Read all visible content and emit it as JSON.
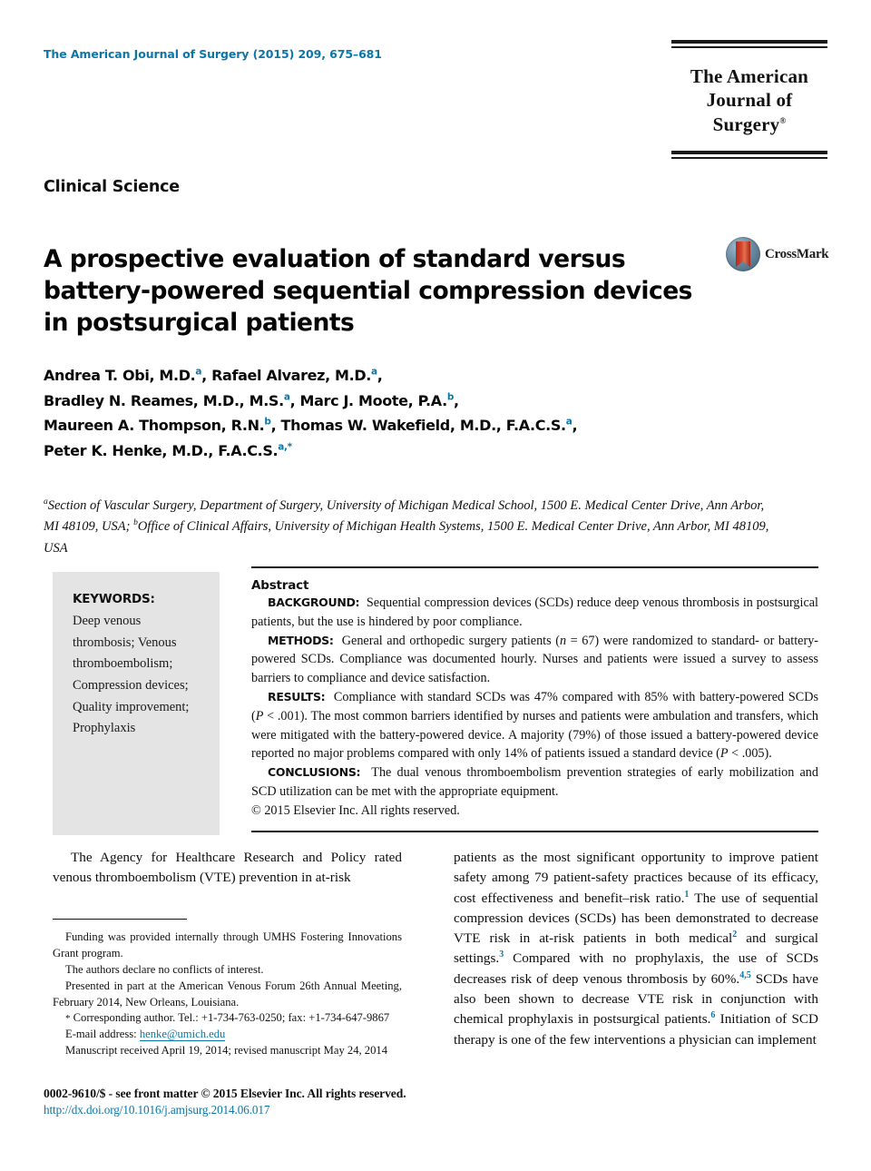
{
  "masthead": {
    "journal_ref": "The American Journal of Surgery (2015) 209, 675–681",
    "logo_line1": "The American",
    "logo_line2": "Journal of Surgery",
    "logo_trademark": "®"
  },
  "section_label": "Clinical Science",
  "title": "A prospective evaluation of standard versus battery-powered sequential compression devices in postsurgical patients",
  "crossmark": {
    "label": "CrossMark"
  },
  "authors": {
    "line1_a": "Andrea T. Obi, M.D.",
    "line1_sup1": "a",
    "line1_b": ", Rafael Alvarez, M.D.",
    "line1_sup2": "a",
    "line1_end": ",",
    "line2_a": "Bradley N. Reames, M.D., M.S.",
    "line2_sup1": "a",
    "line2_b": ", Marc J. Moote, P.A.",
    "line2_sup2": "b",
    "line2_end": ",",
    "line3_a": "Maureen A. Thompson, R.N.",
    "line3_sup1": "b",
    "line3_b": ", Thomas W. Wakefield, M.D., F.A.C.S.",
    "line3_sup2": "a",
    "line3_end": ",",
    "line4_a": "Peter K. Henke, M.D., F.A.C.S.",
    "line4_sup1": "a,",
    "line4_star": "*"
  },
  "affiliations": {
    "sup_a": "a",
    "text_a": "Section of Vascular Surgery, Department of Surgery, University of Michigan Medical School, 1500 E. Medical Center Drive, Ann Arbor, MI 48109, USA; ",
    "sup_b": "b",
    "text_b": "Office of Clinical Affairs, University of Michigan Health Systems, 1500 E. Medical Center Drive, Ann Arbor, MI 48109, USA"
  },
  "keywords": {
    "title": "KEYWORDS:",
    "items": "Deep venous thrombosis; Venous thromboembolism; Compression devices; Quality improvement; Prophylaxis"
  },
  "abstract": {
    "heading": "Abstract",
    "background_label": "BACKGROUND:",
    "background_text": "Sequential compression devices (SCDs) reduce deep venous thrombosis in postsurgical patients, but the use is hindered by poor compliance.",
    "methods_label": "METHODS:",
    "methods_text_1": "General and orthopedic surgery patients (",
    "methods_italic_n": "n",
    "methods_text_2": " = 67) were randomized to standard- or battery-powered SCDs. Compliance was documented hourly. Nurses and patients were issued a survey to assess barriers to compliance and device satisfaction.",
    "results_label": "RESULTS:",
    "results_text_1": "Compliance with standard SCDs was 47% compared with 85% with battery-powered SCDs (",
    "results_italic_p1": "P",
    "results_text_2": " < .001). The most common barriers identified by nurses and patients were ambulation and transfers, which were mitigated with the battery-powered device. A majority (79%) of those issued a battery-powered device reported no major problems compared with only 14% of patients issued a standard device (",
    "results_italic_p2": "P",
    "results_text_3": " < .005).",
    "conclusions_label": "CONCLUSIONS:",
    "conclusions_text": "The dual venous thromboembolism prevention strategies of early mobilization and SCD utilization can be met with the appropriate equipment.",
    "copyright": "© 2015 Elsevier Inc. All rights reserved."
  },
  "body": {
    "left_para": "The Agency for Healthcare Research and Policy rated venous thromboembolism (VTE) prevention in at-risk",
    "right_para_1": "patients as the most significant opportunity to improve patient safety among 79 patient-safety practices because of its efficacy, cost effectiveness and benefit–risk ratio.",
    "right_sup_1": "1",
    "right_para_2": " The use of sequential compression devices (SCDs) has been demonstrated to decrease VTE risk in at-risk patients in both medical",
    "right_sup_2": "2",
    "right_para_3": " and surgical settings.",
    "right_sup_3": "3",
    "right_para_4": " Compared with no prophylaxis, the use of SCDs decreases risk of deep venous thrombosis by 60%.",
    "right_sup_4": "4,5",
    "right_para_5": " SCDs have also been shown to decrease VTE risk in conjunction with chemical prophylaxis in postsurgical patients.",
    "right_sup_5": "6",
    "right_para_6": " Initiation of SCD therapy is one of the few interventions a physician can implement"
  },
  "footnotes": {
    "funding": "Funding was provided internally through UMHS Fostering Innovations Grant program.",
    "conflicts": "The authors declare no conflicts of interest.",
    "presented": "Presented in part at the American Venous Forum 26th Annual Meeting, February 2014, New Orleans, Louisiana.",
    "corresponding_star": "*",
    "corresponding": " Corresponding author. Tel.: +1-734-763-0250; fax: +1-734-647-9867",
    "email_label": "E-mail address:",
    "email": "henke@umich.edu",
    "manuscript": "Manuscript received April 19, 2014; revised manuscript May 24, 2014"
  },
  "bottom": {
    "copyright_line": "0002-9610/$ - see front matter © 2015 Elsevier Inc. All rights reserved.",
    "doi": "http://dx.doi.org/10.1016/j.amjsurg.2014.06.017"
  },
  "colors": {
    "accent_blue": "#0b76a8",
    "keyword_box": "#e4e4e4",
    "rule_black": "#111111"
  }
}
